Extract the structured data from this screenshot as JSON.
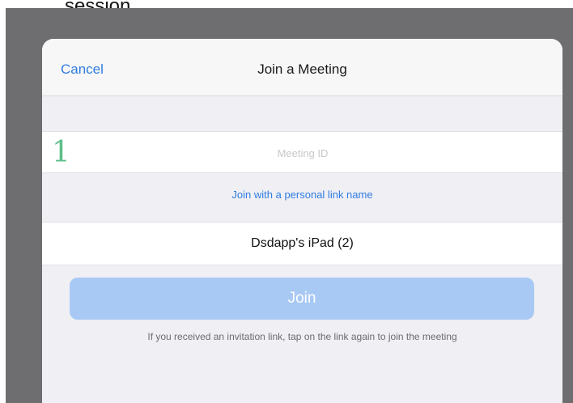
{
  "caption": "session.",
  "navbar": {
    "cancel_label": "Cancel",
    "title": "Join a Meeting"
  },
  "meeting_id": {
    "annotation": "1",
    "value": "",
    "placeholder": "Meeting ID"
  },
  "personal_link_label": "Join with a personal link name",
  "display_name": "Dsdapp's iPad (2)",
  "join_label": "Join",
  "hint": "If you received an invitation link, tap on the link again to join the meeting",
  "colors": {
    "accent": "#2f7de1",
    "join_disabled": "#a9c9f5",
    "annotation": "#5fbf8a"
  }
}
